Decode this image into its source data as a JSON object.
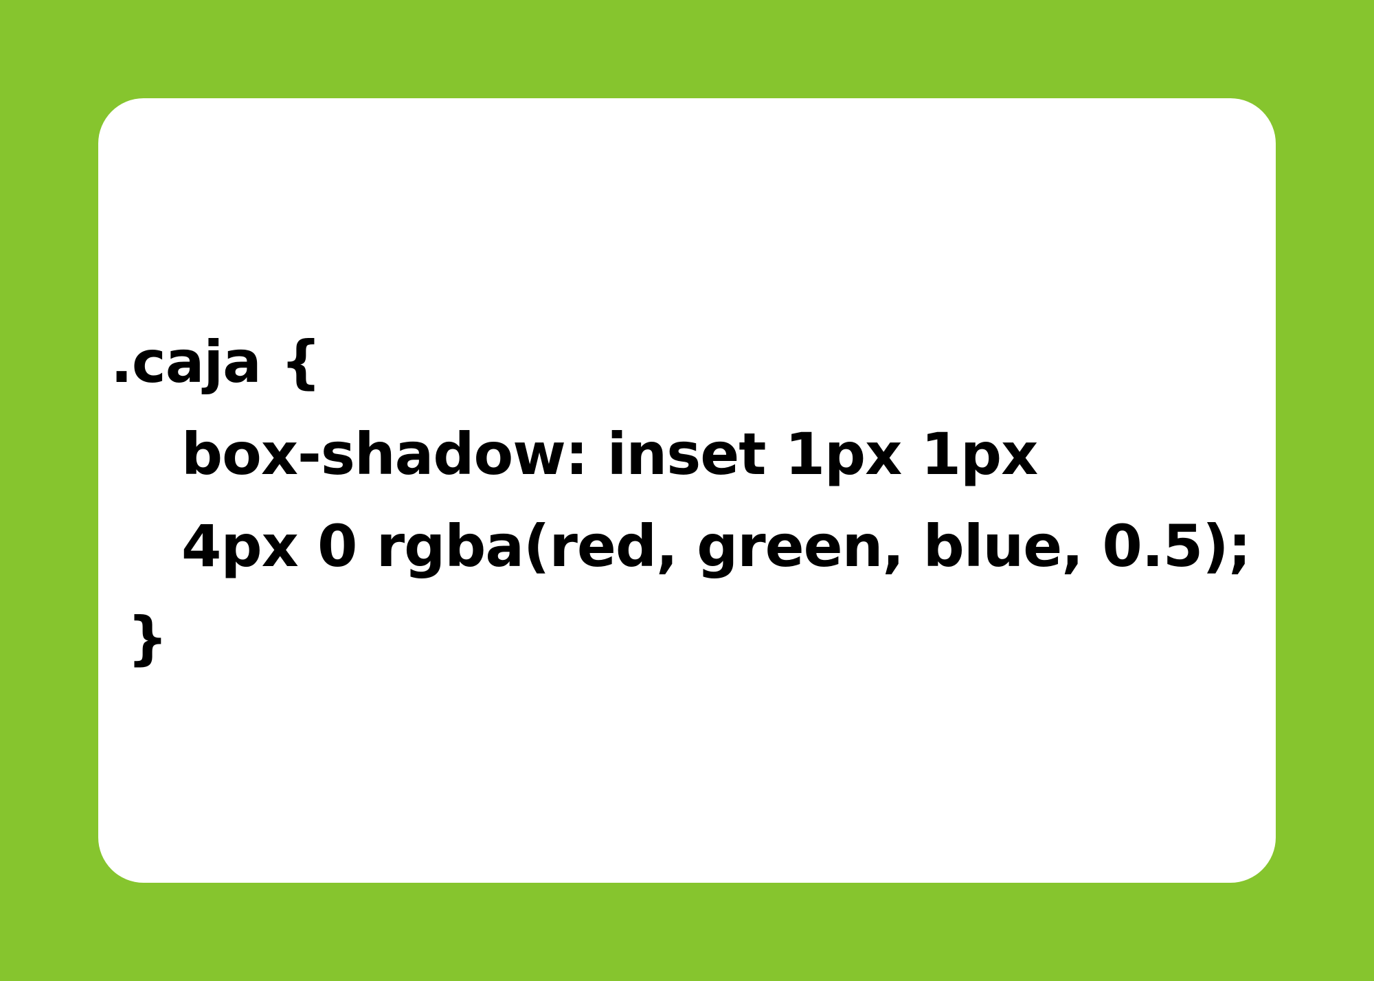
{
  "code": {
    "lines": [
      ".caja {",
      "box-shadow: inset 1px 1px",
      "4px 0 rgba(red, green, blue, 0.5);",
      "}"
    ]
  },
  "colors": {
    "background": "#86C52E",
    "card": "#FFFFFF",
    "text": "#000000"
  }
}
